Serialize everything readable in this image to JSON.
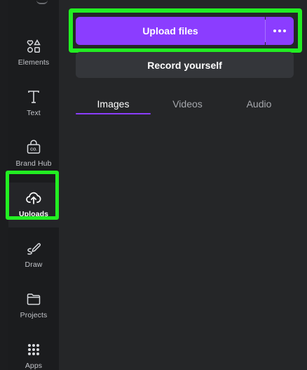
{
  "sidebar": {
    "items": [
      {
        "label": "Elements",
        "icon": "elements-icon"
      },
      {
        "label": "Text",
        "icon": "text-icon"
      },
      {
        "label": "Brand Hub",
        "icon": "brand-hub-icon"
      },
      {
        "label": "Uploads",
        "icon": "upload-cloud-icon",
        "active": true
      },
      {
        "label": "Draw",
        "icon": "draw-icon"
      },
      {
        "label": "Projects",
        "icon": "folder-icon"
      },
      {
        "label": "Apps",
        "icon": "apps-grid-icon"
      }
    ]
  },
  "panel": {
    "upload_label": "Upload files",
    "record_label": "Record yourself",
    "tabs": [
      {
        "label": "Images",
        "active": true
      },
      {
        "label": "Videos"
      },
      {
        "label": "Audio"
      }
    ]
  },
  "colors": {
    "accent": "#8b3dff",
    "highlight": "#22ee22",
    "panel_bg": "#252628",
    "sidebar_bg": "#1b1c1e"
  }
}
